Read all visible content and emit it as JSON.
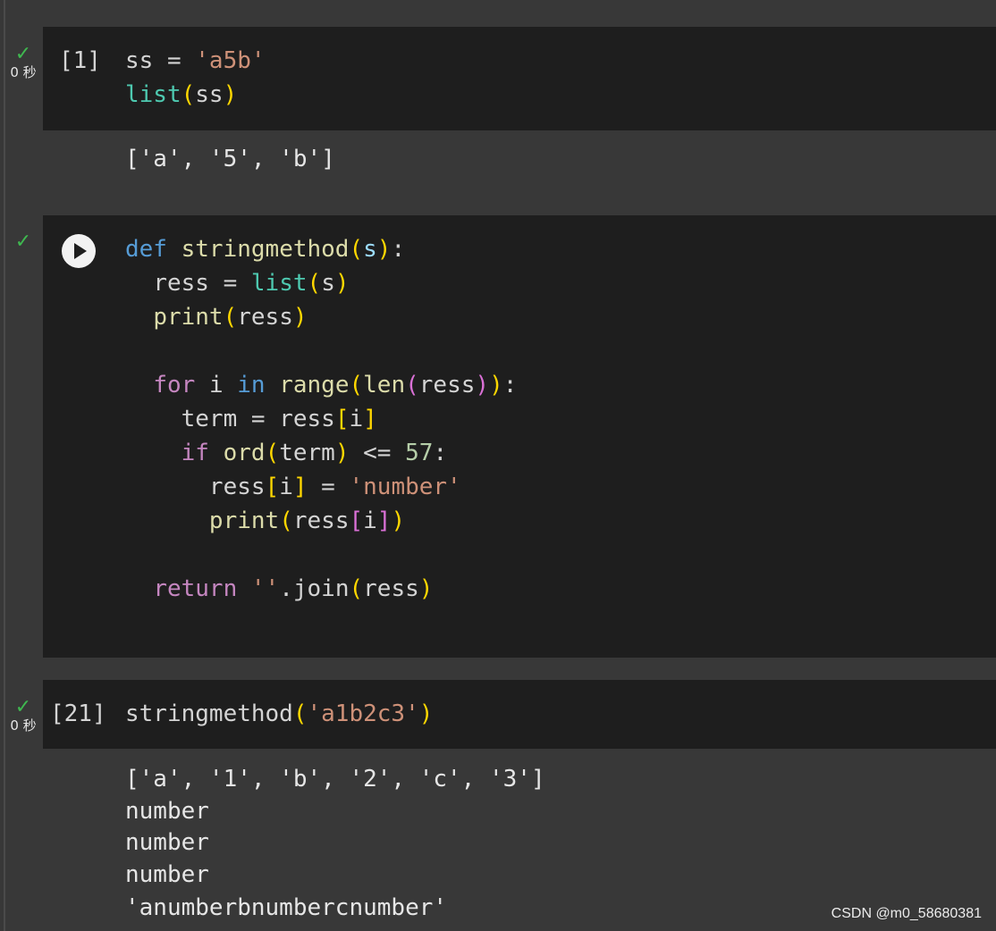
{
  "cells": [
    {
      "exec_count": "[1]",
      "status_check": "✓",
      "duration": "0 秒",
      "output": "['a', '5', 'b']"
    },
    {
      "status_check": "✓",
      "run_button": "play-icon"
    },
    {
      "exec_count": "[21]",
      "status_check": "✓",
      "duration": "0 秒",
      "output_lines": [
        "['a', '1', 'b', '2', 'c', '3']",
        "number",
        "number",
        "number",
        "'anumberbnumbercnumber'"
      ]
    }
  ],
  "code": {
    "ss_var": "ss",
    "ss_assign": " = ",
    "ss_str": "'a5b'",
    "list_fn": "list",
    "ss_arg": "ss",
    "def_kw": "def",
    "fn_name": "stringmethod",
    "param": "s",
    "ress": "ress",
    "print_fn": "print",
    "for_kw": "for",
    "i_var": "i",
    "in_kw": "in",
    "range_fn": "range",
    "len_fn": "len",
    "term": "term",
    "if_kw": "if",
    "ord_fn": "ord",
    "le_op": " <= ",
    "num57": "57",
    "str_number": "'number'",
    "return_kw": "return",
    "empty_str": "''",
    "join": ".join",
    "call_arg": "'a1b2c3'"
  },
  "watermark": "CSDN @m0_58680381",
  "colors": {
    "background": "#383838",
    "cell_background": "#1e1e1e",
    "check": "#3fb950"
  }
}
